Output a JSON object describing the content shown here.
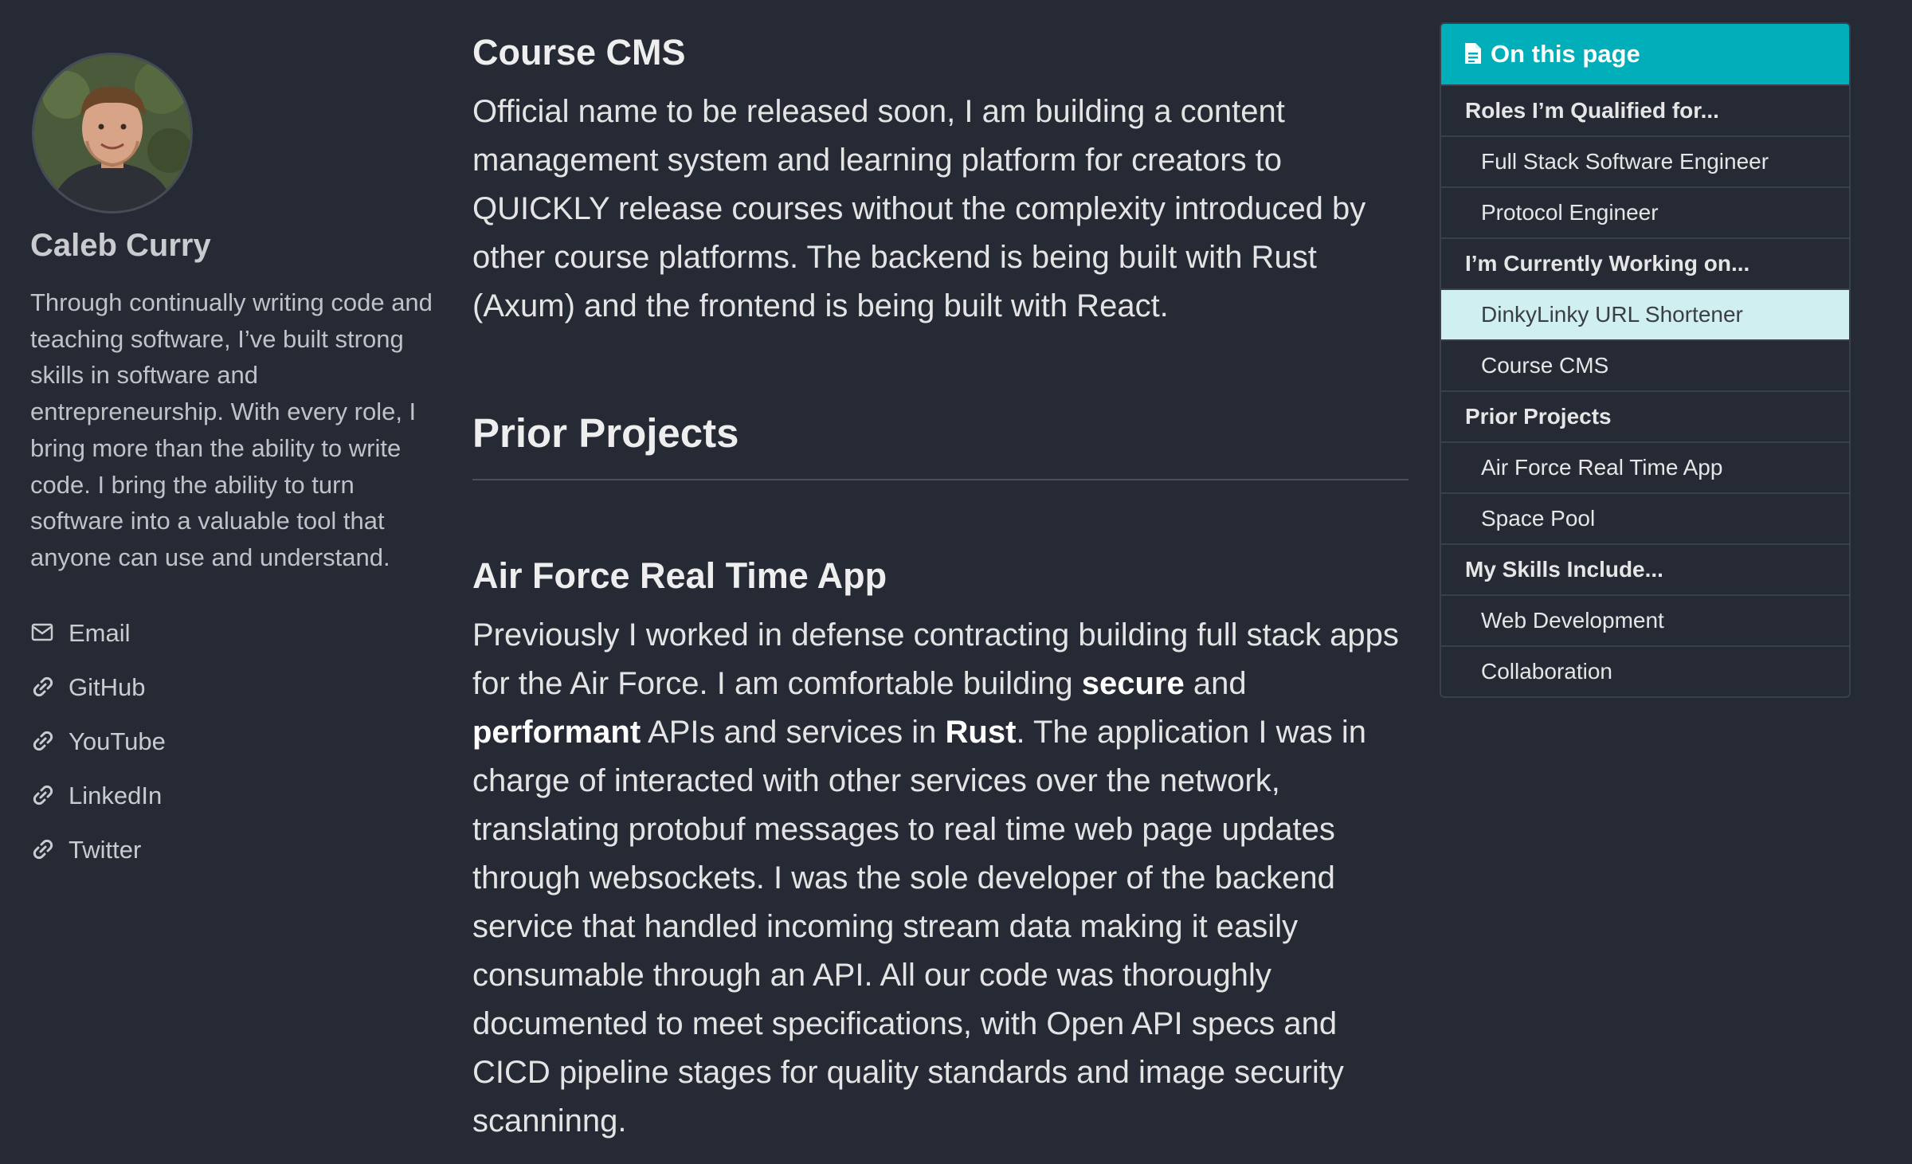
{
  "sidebar": {
    "name": "Caleb Curry",
    "bio": "Through continually writing code and teaching software, I’ve built strong skills in software and entrepreneurship. With every role, I bring more than the ability to write code. I bring the ability to turn software into a valuable tool that anyone can use and understand.",
    "links": [
      {
        "label": "Email",
        "icon": "envelope-icon"
      },
      {
        "label": "GitHub",
        "icon": "link-icon"
      },
      {
        "label": "YouTube",
        "icon": "link-icon"
      },
      {
        "label": "LinkedIn",
        "icon": "link-icon"
      },
      {
        "label": "Twitter",
        "icon": "link-icon"
      }
    ]
  },
  "main": {
    "course_cms_heading": "Course CMS",
    "course_cms_text": "Official name to be released soon, I am building a content management system and learning platform for creators to QUICKLY release courses without the complexity introduced by other course platforms. The backend is being built with Rust (Axum) and the frontend is being built with React.",
    "prior_projects_heading": "Prior Projects",
    "air_force_heading": "Air Force Real Time App",
    "air_force_text": {
      "p1": "Previously I worked in defense contracting building full stack apps for the Air Force. I am comfortable building ",
      "b1": "secure",
      "p2": " and ",
      "b2": "performant",
      "p3": " APIs and services in ",
      "b3": "Rust",
      "p4": ". The application I was in charge of interacted with other services over the network, translating protobuf messages to real time web page updates through websockets. I was the sole developer of the backend service that handled incoming stream data making it easily consumable through an API. All our code was thoroughly documented to meet specifications, with Open API specs and CICD pipeline stages for quality standards and image security scanninng."
    }
  },
  "toc": {
    "title": "On this page",
    "items": [
      {
        "label": "Roles I’m Qualified for...",
        "level": "section"
      },
      {
        "label": "Full Stack Software Engineer",
        "level": "sub"
      },
      {
        "label": "Protocol Engineer",
        "level": "sub"
      },
      {
        "label": "I’m Currently Working on...",
        "level": "section"
      },
      {
        "label": "DinkyLinky URL Shortener",
        "level": "sub",
        "active": true
      },
      {
        "label": "Course CMS",
        "level": "sub"
      },
      {
        "label": "Prior Projects",
        "level": "section"
      },
      {
        "label": "Air Force Real Time App",
        "level": "sub"
      },
      {
        "label": "Space Pool",
        "level": "sub"
      },
      {
        "label": "My Skills Include...",
        "level": "section"
      },
      {
        "label": "Web Development",
        "level": "sub"
      },
      {
        "label": "Collaboration",
        "level": "sub"
      }
    ]
  },
  "colors": {
    "background": "#252a34",
    "accent": "#00aeb9",
    "active_item_bg": "#cfeff1"
  }
}
